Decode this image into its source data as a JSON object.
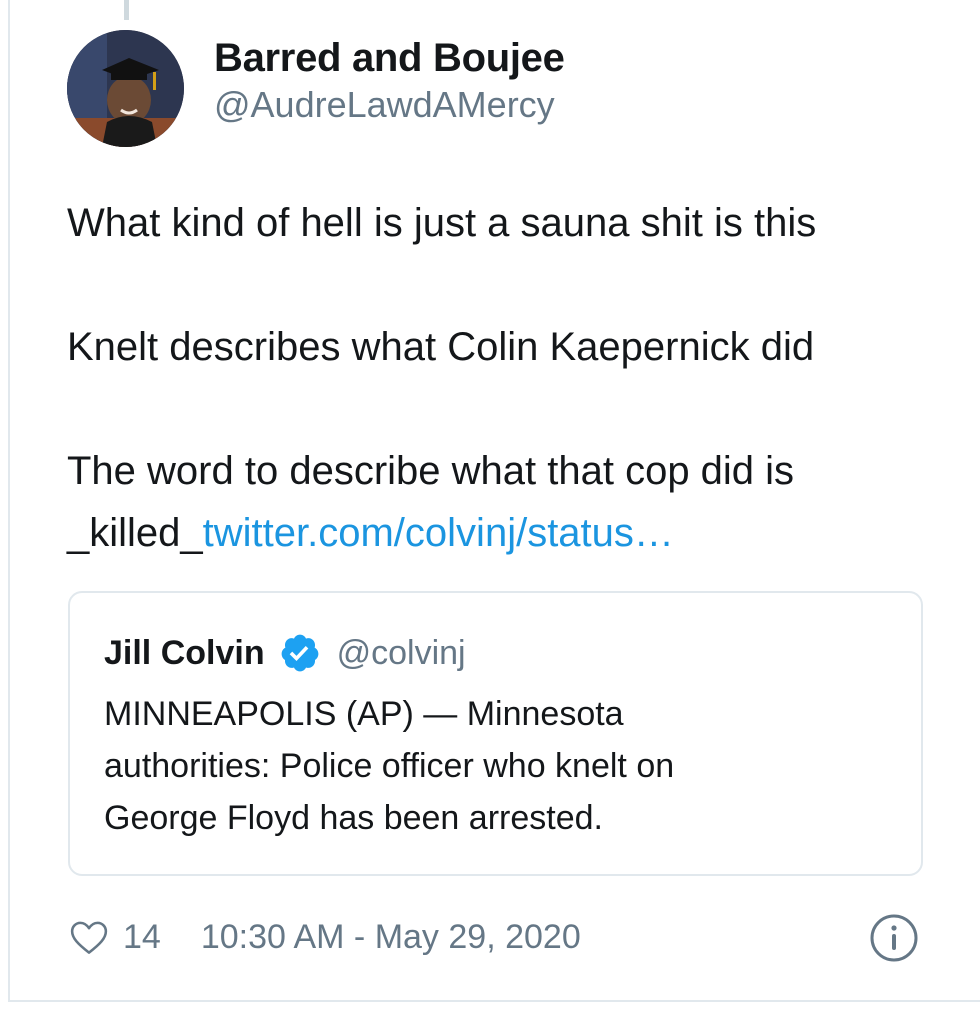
{
  "author": {
    "name": "Barred and Boujee",
    "handle": "@AudreLawdAMercy"
  },
  "tweet": {
    "line1": "What kind of hell is just a sauna shit is this",
    "line2": "Knelt describes what Colin Kaepernick did",
    "line3": "The word to describe what that cop did is",
    "line4_prefix": "_killed_",
    "link_text": "twitter.com/colvinj/status…"
  },
  "quoted_tweet": {
    "name": "Jill Colvin",
    "handle": "@colvinj",
    "line1": "MINNEAPOLIS (AP) — Minnesota",
    "line2": "authorities: Police officer who knelt on",
    "line3": "George Floyd has been arrested."
  },
  "footer": {
    "likes": "14",
    "timestamp": "10:30 AM - May 29, 2020"
  },
  "icons": {
    "like": "heart-icon",
    "verified": "verified-badge-icon",
    "info": "info-icon"
  },
  "colors": {
    "link": "#1b95e0",
    "secondary_text": "#657786",
    "border": "#e1e8ed",
    "verified": "#1da1f2"
  }
}
